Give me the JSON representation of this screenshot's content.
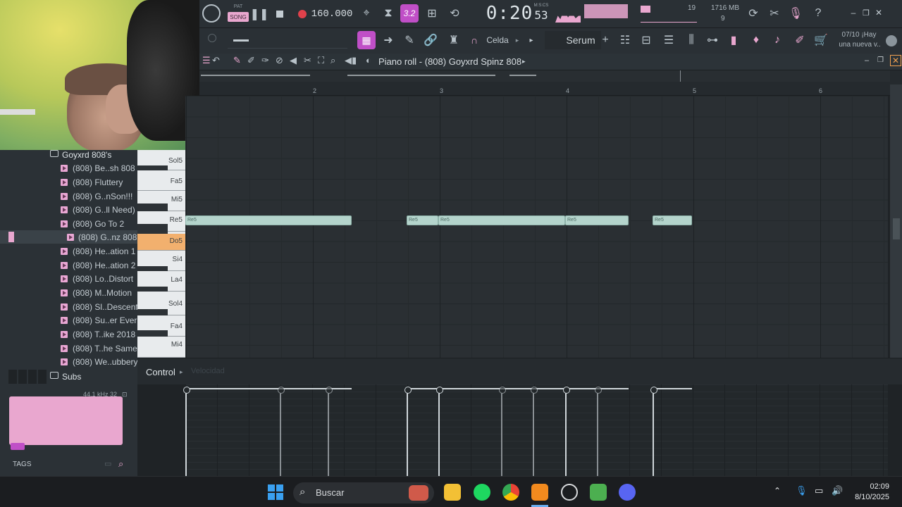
{
  "transport": {
    "pat_label": "PAT",
    "song_label": "SONG",
    "bpm": "160.000",
    "time": "0:20",
    "time_small": "53",
    "time_unit": "M:S:CS",
    "memory_mb": "1716 MB",
    "cpu_value": "19",
    "voices": "9",
    "news_date": "07/10",
    "news_text_line1": "¡Hay",
    "news_text_line2": "una nueva v..",
    "pattern_mode": "3.2"
  },
  "toolbar2": {
    "snap_label": "Celda",
    "plugin_label": "Serum"
  },
  "piano_roll": {
    "title": "Piano roll - (808) Goyxrd Spinz 808",
    "bars": [
      "2",
      "3",
      "4",
      "5",
      "6"
    ]
  },
  "browser": {
    "folder_name": "Goyxrd 808's",
    "items": [
      "(808) Be..sh 808",
      "(808) Fluttery",
      "(808) G..nSon!!!",
      "(808) G..ll Need)",
      "(808) Go To 2",
      "(808) G..nz 808",
      "(808) He..ation 1",
      "(808) He..ation 2",
      "(808) Lo..Distort",
      "(808) M..Motion",
      "(808) Sl..Descent",
      "(808) Su..er Ever",
      "(808) T..ike 2018",
      "(808) T..he Same",
      "(808) We..ubbery"
    ],
    "subs_folder": "Subs",
    "sample_info": "44.1 kHz 32",
    "tags_label": "TAGS"
  },
  "keys": {
    "labels": [
      "Sol5",
      "Fa5",
      "Mi5",
      "Re5",
      "Do5",
      "Si4",
      "La4",
      "Sol4",
      "Fa4",
      "Mi4"
    ]
  },
  "notes": [
    {
      "label": "Re5"
    },
    {
      "label": "Re5"
    },
    {
      "label": "Re5"
    },
    {
      "label": "Re5"
    },
    {
      "label": "Re5"
    }
  ],
  "control": {
    "label": "Control",
    "sub_label": "Velocidad"
  },
  "taskbar": {
    "search_label": "Buscar",
    "time": "02:09",
    "date": "8/10/2025"
  },
  "colors": {
    "accent_pink": "#e9a7cf",
    "note_color": "#b4d4cc",
    "active_key": "#f2b06e",
    "pattern_mode_bg": "#c04fc7"
  }
}
